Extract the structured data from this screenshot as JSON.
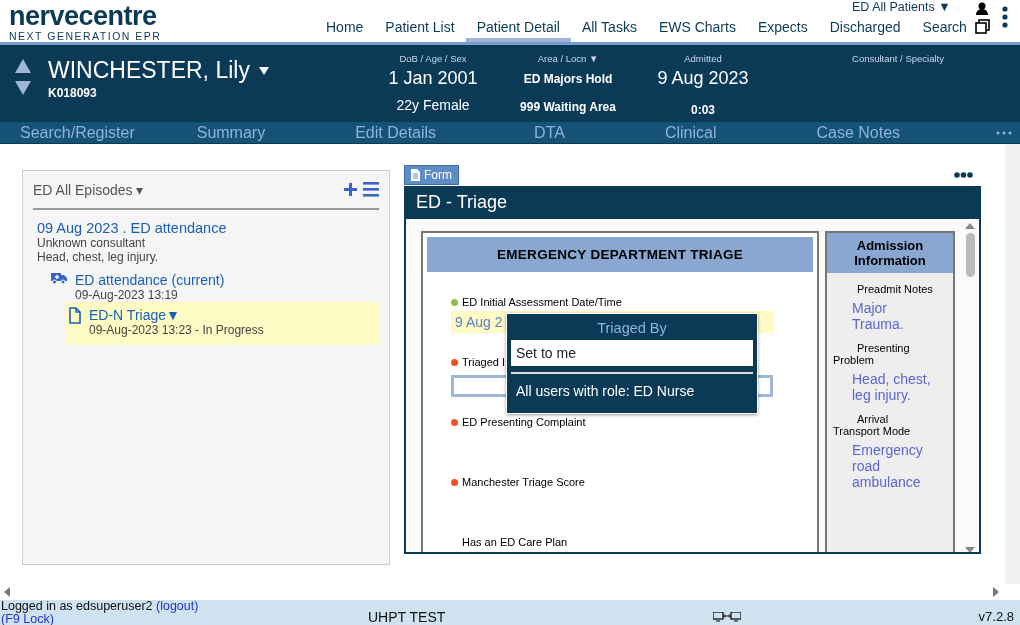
{
  "app": {
    "logo": "nervecentre",
    "tagline": "NEXT GENERATION EPR",
    "patient_list": "ED All Patients ▼"
  },
  "nav": [
    {
      "label": "Home",
      "selected": false
    },
    {
      "label": "Patient List",
      "selected": false
    },
    {
      "label": "Patient Detail",
      "selected": true
    },
    {
      "label": "All Tasks",
      "selected": false
    },
    {
      "label": "EWS Charts",
      "selected": false
    },
    {
      "label": "Expects",
      "selected": false
    },
    {
      "label": "Discharged",
      "selected": false
    },
    {
      "label": "Search",
      "selected": false
    }
  ],
  "patient": {
    "name": "WINCHESTER, Lily",
    "mrn": "K018093",
    "fields": [
      {
        "label": "DoB / Age / Sex",
        "values": [
          "1 Jan 2001",
          "22y Female"
        ]
      },
      {
        "label": "Area / Locn ▼",
        "values": [
          "ED Majors Hold",
          "999 Waiting Area"
        ]
      },
      {
        "label": "Admitted",
        "values": [
          "9 Aug 2023",
          "0:03"
        ]
      },
      {
        "label": "Consultant / Specialty"
      }
    ]
  },
  "menu": [
    "Search/Register",
    "Summary",
    "Edit Details",
    "DTA",
    "Clinical",
    "Case Notes"
  ],
  "episodes": {
    "title": "ED All Episodes ▾",
    "items": [
      {
        "title": "09 Aug 2023 . ED attendance",
        "lines": [
          "Unknown consultant",
          "Head, chest, leg injury."
        ],
        "selected": false,
        "children": [
          {
            "kind": "attendance",
            "title": "ED attendance (current)",
            "lines": [
              "09-Aug-2023 13:19"
            ],
            "selected": false,
            "children": [
              {
                "kind": "form",
                "title": "ED-N Triage▼",
                "lines": [
                  "09-Aug-2023 13:23 - In Progress"
                ],
                "selected": true
              }
            ]
          }
        ]
      }
    ]
  },
  "form": {
    "button": "Form",
    "title": "ED - Triage",
    "heading": "EMERGENCY DEPARTMENT TRIAGE",
    "fields": [
      {
        "label": "ED Initial Assessment Date/Time",
        "color": "#8bc34a",
        "value": "9 Aug 2",
        "kind": "filled"
      },
      {
        "label": "Triaged I",
        "color": "#f4511e",
        "kind": "empty"
      },
      {
        "label": "ED Presenting Complaint",
        "color": "#f4511e",
        "kind": "none"
      },
      {
        "label": "Manchester Triage Score",
        "color": "#f4511e",
        "kind": "none"
      },
      {
        "label": "Has an ED Care Plan",
        "kind": "none"
      }
    ],
    "side": {
      "title": "Admission Information",
      "items": [
        {
          "label": "Preadmit Notes",
          "value": "Major Trauma."
        },
        {
          "label": "Presenting Problem",
          "value": "Head, chest, leg injury."
        },
        {
          "label": "Arrival Transport Mode",
          "value": "Emergency road ambulance"
        }
      ]
    },
    "popup": {
      "title": "Triaged By",
      "options": [
        {
          "label": "Set to me",
          "selected": true
        },
        {
          "label": "All users with role: ED Nurse",
          "selected": false
        }
      ]
    }
  },
  "footer": {
    "login": "Logged in as edsuperuser2",
    "logout": "(logout)",
    "lock": "(F9 Lock)",
    "env": "UHPT TEST",
    "version": "v7.2.8"
  }
}
